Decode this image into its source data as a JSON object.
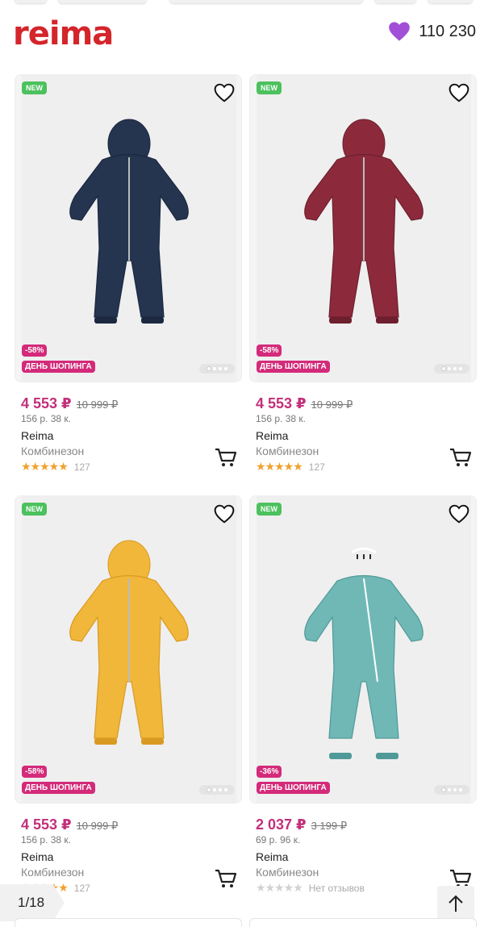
{
  "header": {
    "logo_text": "reima",
    "logo_color": "#d4252b",
    "favorites_icon": "heart-icon",
    "favorites_color": "#a24fd8",
    "favorites_count": "110 230"
  },
  "products": [
    {
      "badge_new": "NEW",
      "discount": "-58%",
      "promo": "ДЕНЬ ШОПИНГА",
      "price": "4 553 ₽",
      "old_price": "10 999 ₽",
      "installment": "156 р. 38 к.",
      "brand": "Reima",
      "type": "Комбинезон",
      "rating": 5,
      "reviews": "127",
      "color": "#25344f"
    },
    {
      "badge_new": "NEW",
      "discount": "-58%",
      "promo": "ДЕНЬ ШОПИНГА",
      "price": "4 553 ₽",
      "old_price": "10 999 ₽",
      "installment": "156 р. 38 к.",
      "brand": "Reima",
      "type": "Комбинезон",
      "rating": 5,
      "reviews": "127",
      "color": "#8c2a3c"
    },
    {
      "badge_new": "NEW",
      "discount": "-58%",
      "promo": "ДЕНЬ ШОПИНГА",
      "price": "4 553 ₽",
      "old_price": "10 999 ₽",
      "installment": "156 р. 38 к.",
      "brand": "Reima",
      "type": "Комбинезон",
      "rating": 5,
      "reviews": "127",
      "color": "#f1b73a"
    },
    {
      "badge_new": "NEW",
      "discount": "-36%",
      "promo": "ДЕНЬ ШОПИНГА",
      "price": "2 037 ₽",
      "old_price": "3 199 ₽",
      "installment": "69 р. 96 к.",
      "brand": "Reima",
      "type": "Комбинезон",
      "rating": 0,
      "reviews": "Нет отзывов",
      "color": "#6fb8b6"
    }
  ],
  "pagination": {
    "indicator": "1/18"
  },
  "scroll_top_icon": "arrow-up-icon"
}
